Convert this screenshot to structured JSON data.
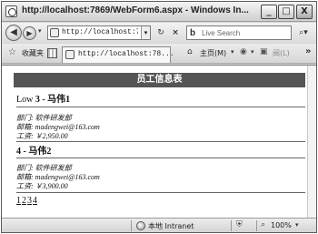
{
  "window": {
    "title": "http://localhost:7869/WebForm6.aspx - Windows In...",
    "min_glyph": "_",
    "max_glyph": "□",
    "close_glyph": "X"
  },
  "navbar": {
    "back_glyph": "◀",
    "forward_glyph": "▶",
    "history_drop": "▾",
    "address": "http://localhost:7",
    "address_drop": "▾",
    "refresh_glyph": "↻",
    "stop_glyph": "×",
    "search_placeholder": "Live Search",
    "search_logo": "b",
    "search_btn": "⌕▾"
  },
  "cmdbar": {
    "favorites_label": "收藏夹",
    "tab_title": "http://localhost:78...",
    "home_label": "主页(M)",
    "read_label": "阅(L)",
    "more": "»"
  },
  "page": {
    "table_title": "员工信息表",
    "records": [
      {
        "prefix": "Low",
        "title": "3 - 马伟1",
        "dept": "部门: 软件研发部",
        "email": "邮箱: madengwei@163.com",
        "salary": "工资: ￥2,950.00"
      },
      {
        "prefix": "",
        "title": "4 - 马伟2",
        "dept": "部门: 软件研发部",
        "email": "邮箱: madengwei@163.com",
        "salary": "工资: ￥3,900.00"
      }
    ],
    "pager": [
      "1",
      "2",
      "3",
      "4"
    ]
  },
  "statusbar": {
    "zone": "本地 Intranet",
    "zoom": "100%",
    "zoom_drop": "▾"
  },
  "icons": {
    "favorites": "star-icon",
    "home": "home-icon",
    "feeds": "feeds-icon",
    "print": "print-icon",
    "zone": "globe-icon",
    "protected": "shield-icon",
    "zoom": "magnifier-icon"
  }
}
